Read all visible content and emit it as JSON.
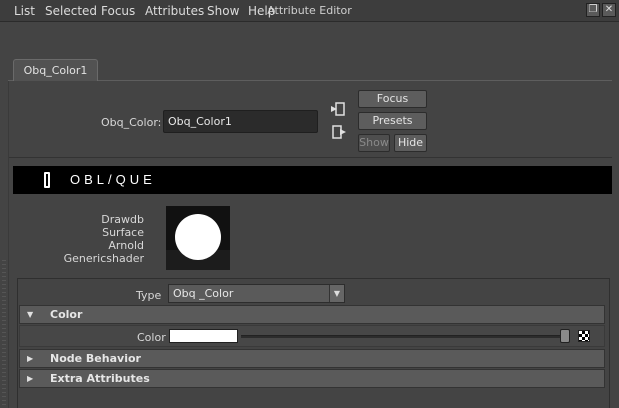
{
  "window": {
    "title": "Attribute Editor"
  },
  "menu": [
    "List",
    "Selected",
    "Focus",
    "Attributes",
    "Show",
    "Help"
  ],
  "tab": {
    "label": "Obq_Color1"
  },
  "node": {
    "label": "Obq_Color:",
    "value": "Obq_Color1"
  },
  "buttons": {
    "focus": "Focus",
    "presets": "Presets",
    "show": "Show",
    "hide": "Hide"
  },
  "banner": {
    "text": "OBL/QUE"
  },
  "classification": [
    "Drawdb",
    "Surface",
    "Arnold",
    "Genericshader"
  ],
  "type": {
    "label": "Type",
    "value": "Obq _Color"
  },
  "sections": {
    "color": {
      "title": "Color",
      "expanded": true
    },
    "node_behavior": {
      "title": "Node Behavior",
      "expanded": false
    },
    "extra": {
      "title": "Extra Attributes",
      "expanded": false
    }
  },
  "color_attr": {
    "label": "Color",
    "value_hex": "#ffffff",
    "slider_fraction": 1.0
  },
  "icons": {
    "restore": "restore-icon",
    "close": "close-icon",
    "input_connection": "input-connection-icon",
    "output_connection": "output-connection-icon",
    "map_button": "checker-map-icon"
  }
}
